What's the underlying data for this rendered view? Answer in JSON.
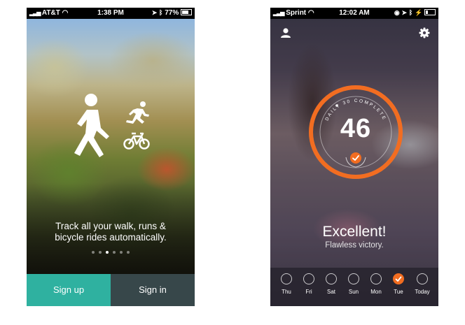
{
  "phone1": {
    "status": {
      "carrier": "AT&T",
      "time": "1:38 PM",
      "battery": "77%"
    },
    "icons": [
      "walking-icon",
      "running-icon",
      "bicycle-icon"
    ],
    "tagline_line1": "Track all your walk, runs &",
    "tagline_line2": "bicycle rides automatically.",
    "pagination": {
      "count": 6,
      "active_index": 2
    },
    "signup_label": "Sign up",
    "signin_label": "Sign in",
    "colors": {
      "signup": "#2fb1a0",
      "signin": "#37474a"
    }
  },
  "phone2": {
    "status": {
      "carrier": "Sprint",
      "time": "12:02 AM"
    },
    "icons": [
      "profile-icon",
      "gear-icon",
      "checkmark-badge-icon"
    ],
    "ring": {
      "label": "DAILY 30 COMPLETE",
      "value": "46",
      "progress": 1.0,
      "color": "#f26d21"
    },
    "headline": "Excellent!",
    "subline": "Flawless victory.",
    "days": [
      {
        "label": "Thu",
        "done": false
      },
      {
        "label": "Fri",
        "done": false
      },
      {
        "label": "Sat",
        "done": false
      },
      {
        "label": "Sun",
        "done": false
      },
      {
        "label": "Mon",
        "done": false
      },
      {
        "label": "Tue",
        "done": true
      },
      {
        "label": "Today",
        "done": false
      }
    ]
  }
}
